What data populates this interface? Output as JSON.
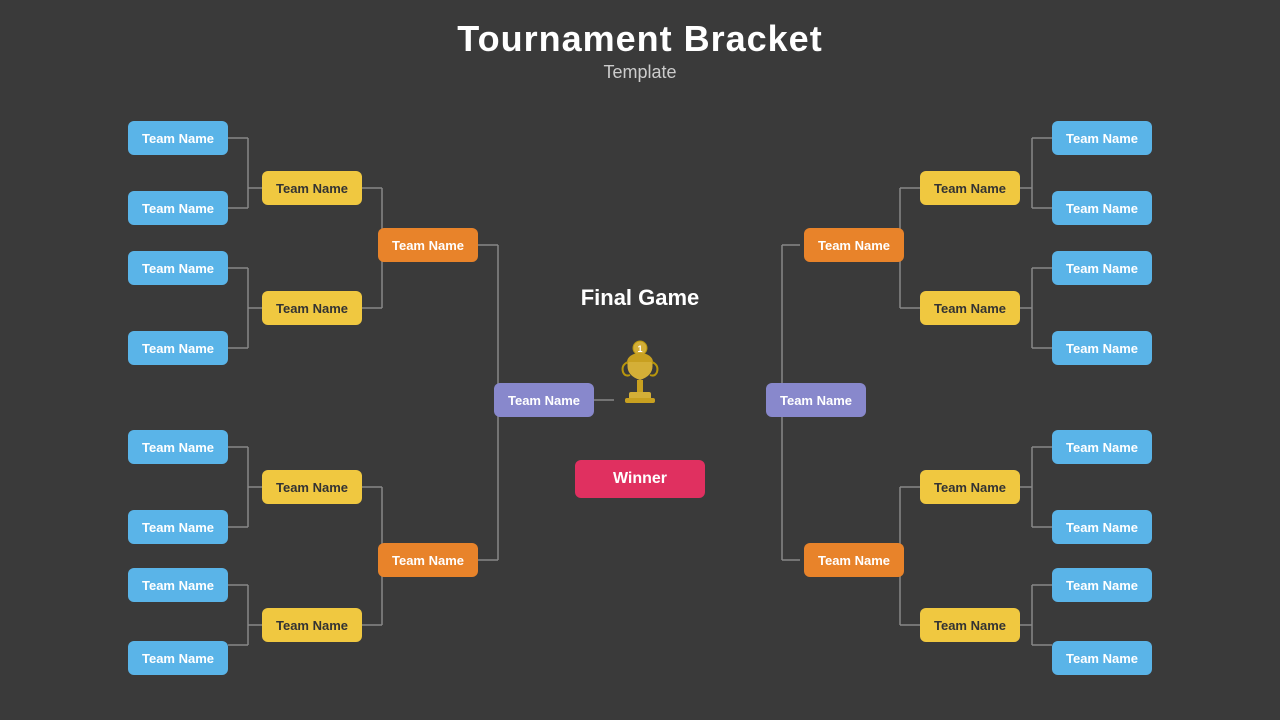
{
  "title": "Tournament Bracket",
  "subtitle": "Template",
  "final_game_label": "Final  Game",
  "winner_label": "Winner",
  "team_label": "Team Name",
  "colors": {
    "blue": "#5ab4e8",
    "yellow": "#f0c840",
    "orange": "#e8832a",
    "purple": "#8888cc",
    "red": "#e03060",
    "bg": "#3a3a3a",
    "line": "#888888"
  }
}
